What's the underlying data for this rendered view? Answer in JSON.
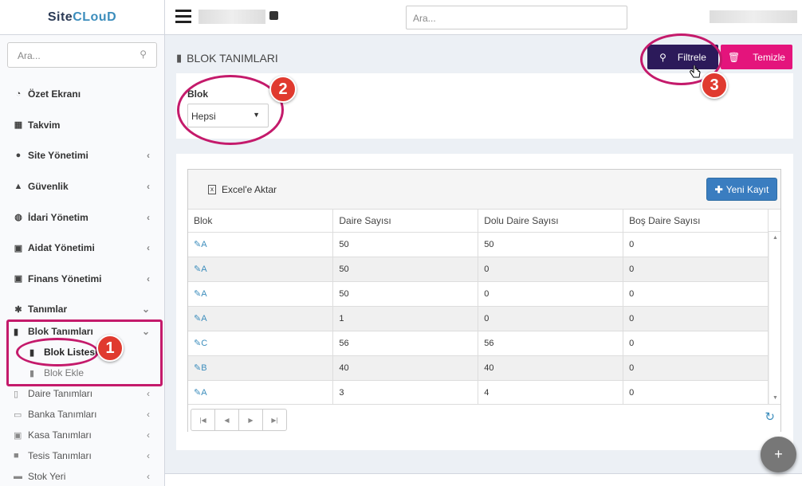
{
  "brand": {
    "name_a": "Site",
    "name_b": "CLouD"
  },
  "sidebar": {
    "search_placeholder": "Ara...",
    "items": [
      {
        "label": "Özet Ekranı",
        "icon": "dashboard-icon",
        "glyph": "◔"
      },
      {
        "label": "Takvim",
        "icon": "calendar-icon",
        "glyph": "▦"
      },
      {
        "label": "Site Yönetimi",
        "icon": "users-icon",
        "glyph": "●"
      },
      {
        "label": "Güvenlik",
        "icon": "user-secret-icon",
        "glyph": "▲"
      },
      {
        "label": "İdari Yönetim",
        "icon": "globe-icon",
        "glyph": "◍"
      },
      {
        "label": "Aidat Yönetimi",
        "icon": "money-icon",
        "glyph": "▣"
      },
      {
        "label": "Finans Yönetimi",
        "icon": "money-icon",
        "glyph": "▣"
      },
      {
        "label": "Tanımlar",
        "icon": "gear-icon",
        "glyph": "✱"
      }
    ],
    "blok_tanimlari": "Blok Tanımları",
    "blok_listesi": "Blok Listesi",
    "blok_ekle": "Blok Ekle",
    "more": [
      {
        "label": "Daire Tanımları",
        "icon": "building-icon"
      },
      {
        "label": "Banka Tanımları",
        "icon": "credit-card-icon"
      },
      {
        "label": "Kasa Tanımları",
        "icon": "money-icon"
      },
      {
        "label": "Tesis Tanımları",
        "icon": "square-icon"
      },
      {
        "label": "Stok Yeri",
        "icon": "folder-icon"
      }
    ]
  },
  "topbar": {
    "search_placeholder": "Ara..."
  },
  "page": {
    "title": "BLOK TANIMLARI"
  },
  "actions": {
    "filter": "Filtrele",
    "clear": "Temizle"
  },
  "filter": {
    "label": "Blok",
    "selected": "Hepsi"
  },
  "grid": {
    "export": "Excel'e Aktar",
    "new": "Yeni Kayıt",
    "columns": [
      "Blok",
      "Daire Sayısı",
      "Dolu Daire Sayısı",
      "Boş Daire Sayısı"
    ],
    "rows": [
      [
        "A",
        "50",
        "50",
        "0"
      ],
      [
        "A",
        "50",
        "0",
        "0"
      ],
      [
        "A",
        "50",
        "0",
        "0"
      ],
      [
        "A",
        "1",
        "0",
        "0"
      ],
      [
        "C",
        "56",
        "56",
        "0"
      ],
      [
        "B",
        "40",
        "40",
        "0"
      ],
      [
        "A",
        "3",
        "4",
        "0"
      ]
    ]
  },
  "annotations": {
    "b1": "1",
    "b2": "2",
    "b3": "3"
  },
  "colors": {
    "primary_dark": "#2c1a5a",
    "pink": "#e4147c",
    "link": "#3c8dbc",
    "annotation": "#c41a6b"
  }
}
